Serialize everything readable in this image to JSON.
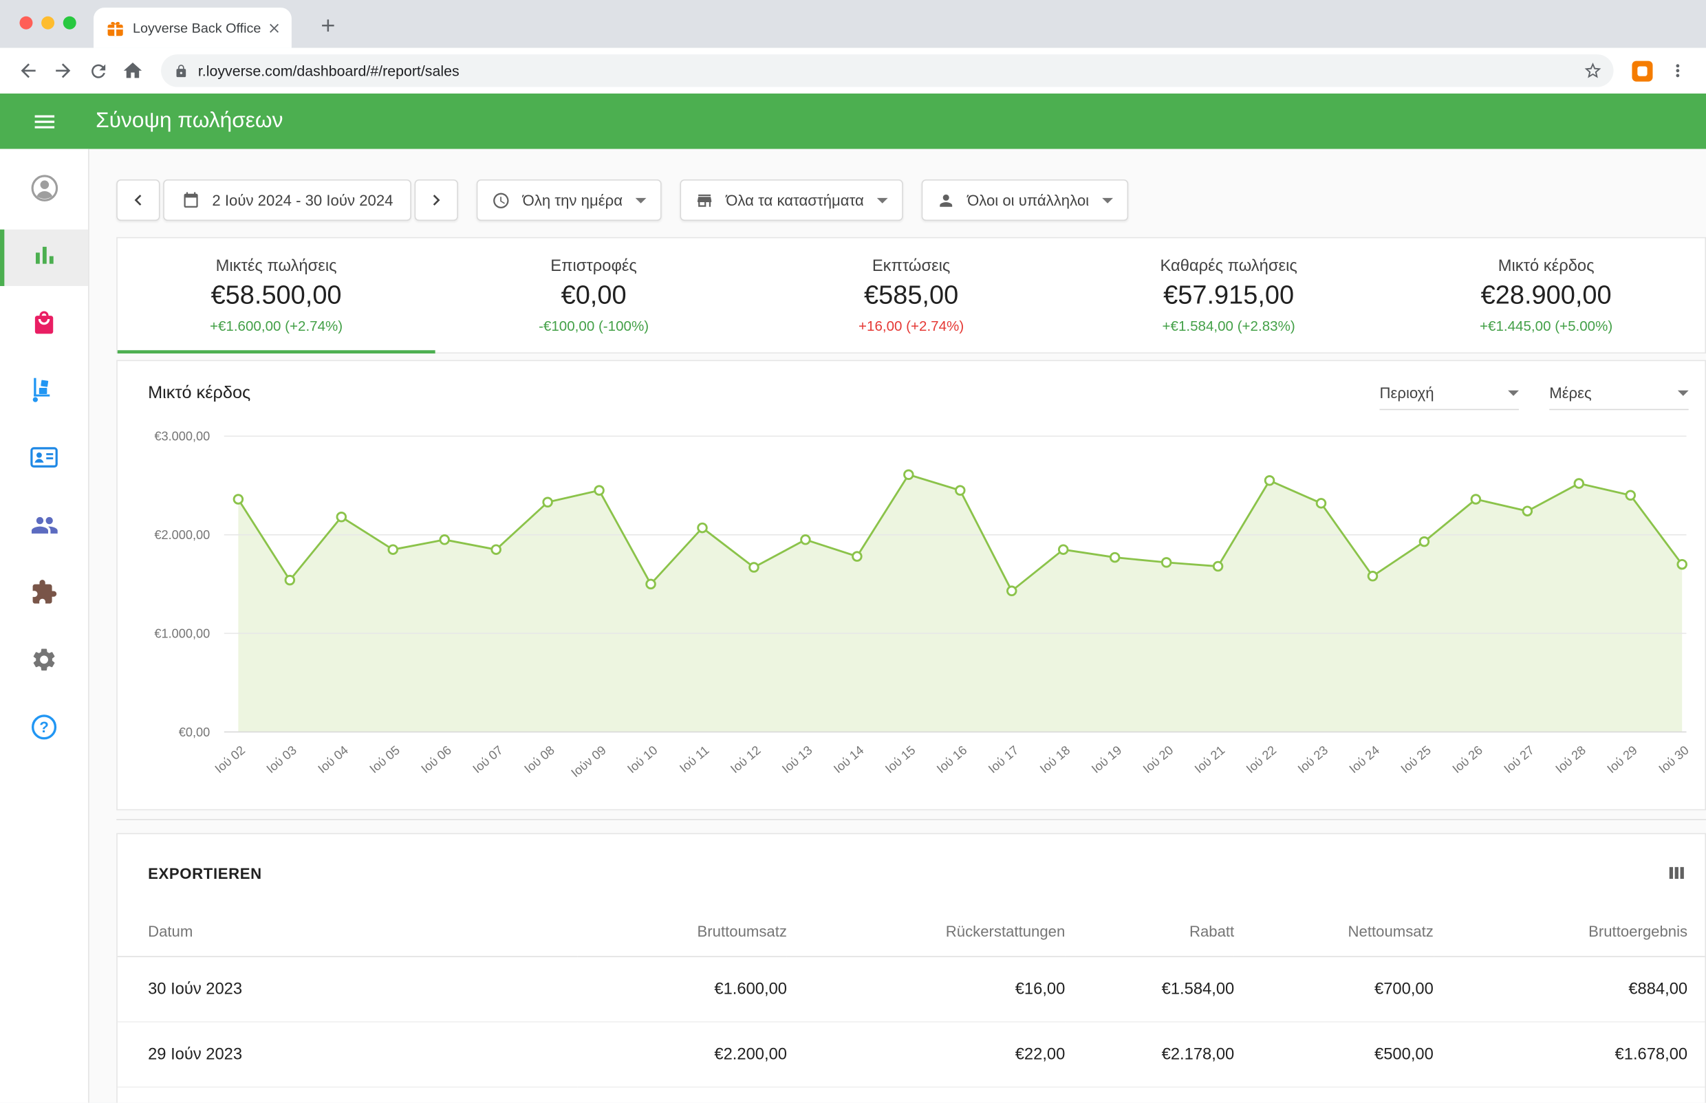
{
  "colors": {
    "accent_green": "#4caf50",
    "chart_line": "#8bc34a",
    "chart_fill": "#edf5e0",
    "positive": "#43a047",
    "negative": "#e53935"
  },
  "browser": {
    "tab_title": "Loyverse Back Office",
    "url": "r.loyverse.com/dashboard/#/report/sales"
  },
  "appbar": {
    "title": "Σύνοψη πωλήσεων"
  },
  "sidebar": {
    "items": [
      {
        "icon": "account-circle-icon"
      },
      {
        "icon": "reports-bar-chart-icon",
        "active": true
      },
      {
        "icon": "items-shopping-bag-icon"
      },
      {
        "icon": "inventory-trolley-icon"
      },
      {
        "icon": "customers-contact-card-icon"
      },
      {
        "icon": "employees-people-icon"
      },
      {
        "icon": "integrations-puzzle-icon"
      },
      {
        "icon": "settings-gear-icon"
      },
      {
        "icon": "help-icon"
      }
    ]
  },
  "toolbar": {
    "date_range": "2 Ιούν 2024 - 30 Ιούν 2024",
    "time_filter": "Όλη την ημέρα",
    "store_filter": "Όλα τα καταστήματα",
    "employee_filter": "Όλοι οι υπάλληλοι"
  },
  "metrics": [
    {
      "label": "Μικτές πωλήσεις",
      "value": "€58.500,00",
      "delta": "+€1.600,00 (+2.74%)",
      "delta_color": "green",
      "active": true
    },
    {
      "label": "Επιστροφές",
      "value": "€0,00",
      "delta": "-€100,00 (-100%)",
      "delta_color": "green",
      "active": false
    },
    {
      "label": "Εκπτώσεις",
      "value": "€585,00",
      "delta": "+16,00 (+2.74%)",
      "delta_color": "red",
      "active": false
    },
    {
      "label": "Καθαρές πωλήσεις",
      "value": "€57.915,00",
      "delta": "+€1.584,00 (+2.83%)",
      "delta_color": "green",
      "active": false
    },
    {
      "label": "Μικτό κέρδος",
      "value": "€28.900,00",
      "delta": "+€1.445,00 (+5.00%)",
      "delta_color": "green",
      "active": false
    }
  ],
  "chart": {
    "title": "Μικτό κέρδος",
    "region_select": "Περιοχή",
    "granularity_select": "Μέρες"
  },
  "chart_data": {
    "type": "area",
    "title": "Μικτό κέρδος",
    "x": [
      "Ιού 02",
      "Ιού 03",
      "Ιού 04",
      "Ιού 05",
      "Ιού 06",
      "Ιού 07",
      "Ιού 08",
      "Ιούν 09",
      "Ιού 10",
      "Ιού 11",
      "Ιού 12",
      "Ιού 13",
      "Ιού 14",
      "Ιού 15",
      "Ιού 16",
      "Ιού 17",
      "Ιού 18",
      "Ιού 19",
      "Ιού 20",
      "Ιού 21",
      "Ιού 22",
      "Ιού 23",
      "Ιού 24",
      "Ιού 25",
      "Ιού 26",
      "Ιού 27",
      "Ιού 28",
      "Ιού 29",
      "Ιού 30"
    ],
    "values": [
      2360,
      1540,
      2180,
      1850,
      1950,
      1850,
      2330,
      2450,
      1500,
      2070,
      1670,
      1950,
      1780,
      2610,
      2450,
      1430,
      1850,
      1770,
      1720,
      1680,
      2550,
      2320,
      1580,
      1930,
      2360,
      2240,
      2520,
      2400,
      1700
    ],
    "ylim": [
      0,
      3000
    ],
    "yticks": [
      {
        "value": 0,
        "label": "€0,00"
      },
      {
        "value": 1000,
        "label": "€1.000,00"
      },
      {
        "value": 2000,
        "label": "€2.000,00"
      },
      {
        "value": 3000,
        "label": "€3.000,00"
      }
    ],
    "line_color": "#8bc34a",
    "fill_color": "#edf5e0",
    "grid": "horizontal",
    "legend": "none"
  },
  "table": {
    "export_label": "EXPORTIEREN",
    "headers": [
      "Datum",
      "Bruttoumsatz",
      "Rückerstattungen",
      "Rabatt",
      "Nettoumsatz",
      "Bruttoergebnis"
    ],
    "rows": [
      [
        "30 Ιούν 2023",
        "€1.600,00",
        "€16,00",
        "€1.584,00",
        "€700,00",
        "€884,00"
      ],
      [
        "29 Ιούν 2023",
        "€2.200,00",
        "€22,00",
        "€2.178,00",
        "€500,00",
        "€1.678,00"
      ]
    ]
  }
}
